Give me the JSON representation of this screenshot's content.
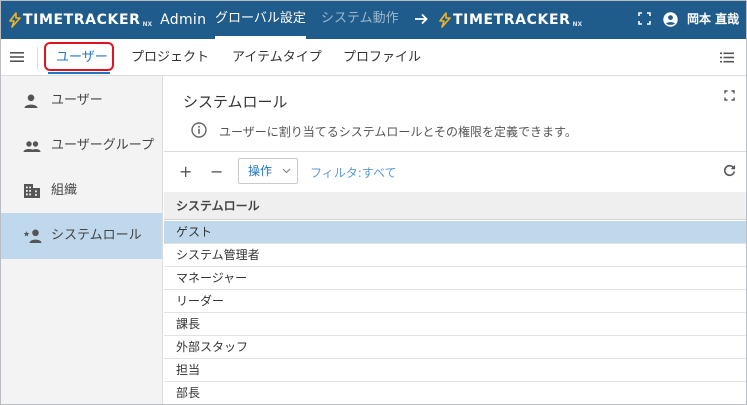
{
  "header": {
    "logo_left": {
      "brand": "TIMETRACKER",
      "suffix": "NX",
      "subtitle": "Admin"
    },
    "nav": [
      {
        "label": "グローバル設定",
        "active": true
      },
      {
        "label": "システム動作",
        "active": false
      }
    ],
    "logo_right": {
      "brand": "TIMETRACKER",
      "suffix": "NX"
    },
    "user_name": "岡本 直哉",
    "bar_color": "#1f5c8b"
  },
  "tabs": [
    {
      "label": "ユーザー",
      "active": true
    },
    {
      "label": "プロジェクト",
      "active": false
    },
    {
      "label": "アイテムタイプ",
      "active": false
    },
    {
      "label": "プロファイル",
      "active": false
    }
  ],
  "sidebar": {
    "items": [
      {
        "label": "ユーザー",
        "icon": "person-icon",
        "selected": false
      },
      {
        "label": "ユーザーグループ",
        "icon": "people-icon",
        "selected": false
      },
      {
        "label": "組織",
        "icon": "building-icon",
        "selected": false
      },
      {
        "label": "システムロール",
        "icon": "star-person-icon",
        "selected": true
      }
    ]
  },
  "main": {
    "title": "システムロール",
    "info": "ユーザーに割り当てるシステムロールとその権限を定義できます。",
    "toolbar": {
      "add": "+",
      "remove": "−",
      "operations": "操作",
      "filter": "フィルタ:すべて"
    },
    "table": {
      "header": "システムロール",
      "rows": [
        {
          "name": "ゲスト",
          "selected": true
        },
        {
          "name": "システム管理者",
          "selected": false
        },
        {
          "name": "マネージャー",
          "selected": false
        },
        {
          "name": "リーダー",
          "selected": false
        },
        {
          "name": "課長",
          "selected": false
        },
        {
          "name": "外部スタッフ",
          "selected": false
        },
        {
          "name": "担当",
          "selected": false
        },
        {
          "name": "部長",
          "selected": false
        }
      ]
    }
  },
  "colors": {
    "accent": "#1f77c4",
    "selection": "#bfd8ec",
    "highlight_box": "#e0141e"
  }
}
